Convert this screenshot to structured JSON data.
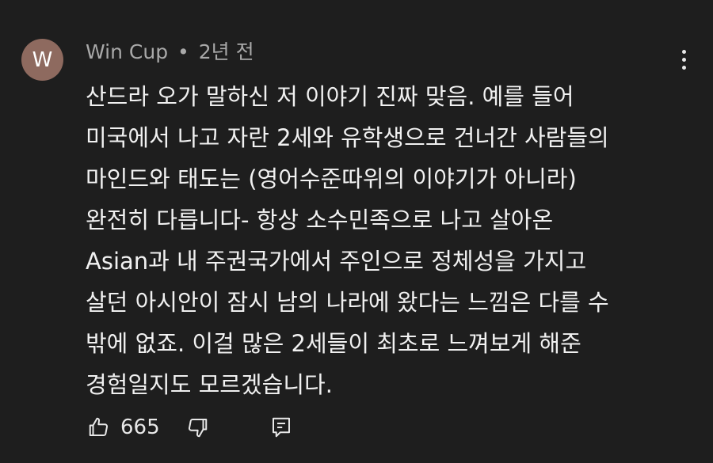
{
  "comment": {
    "avatar_letter": "W",
    "avatar_color": "#8e6a5f",
    "author": "Win Cup",
    "separator": "•",
    "timestamp": "2년 전",
    "text_lines": [
      "산드라 오가 말하신 저 이야기 진짜 맞음. 예를 들어",
      "미국에서 나고 자란 2세와 유학생으로 건너간 사람들의",
      "마인드와 태도는 (영어수준따위의 이야기가 아니라)",
      "완전히 다릅니다- 항상 소수민족으로 나고 살아온",
      "Asian과 내 주권국가에서 주인으로 정체성을 가지고",
      "살던 아시안이 잠시 남의 나라에 왔다는 느낌은 다를 수",
      "밖에 없죠. 이걸 많은 2세들이 최초로 느껴보게 해준",
      "경험일지도 모르겠습니다."
    ],
    "like_count": "665",
    "icons": {
      "like": "thumbs-up-icon",
      "dislike": "thumbs-down-icon",
      "reply": "reply-comment-icon",
      "menu": "more-vertical-icon"
    }
  }
}
